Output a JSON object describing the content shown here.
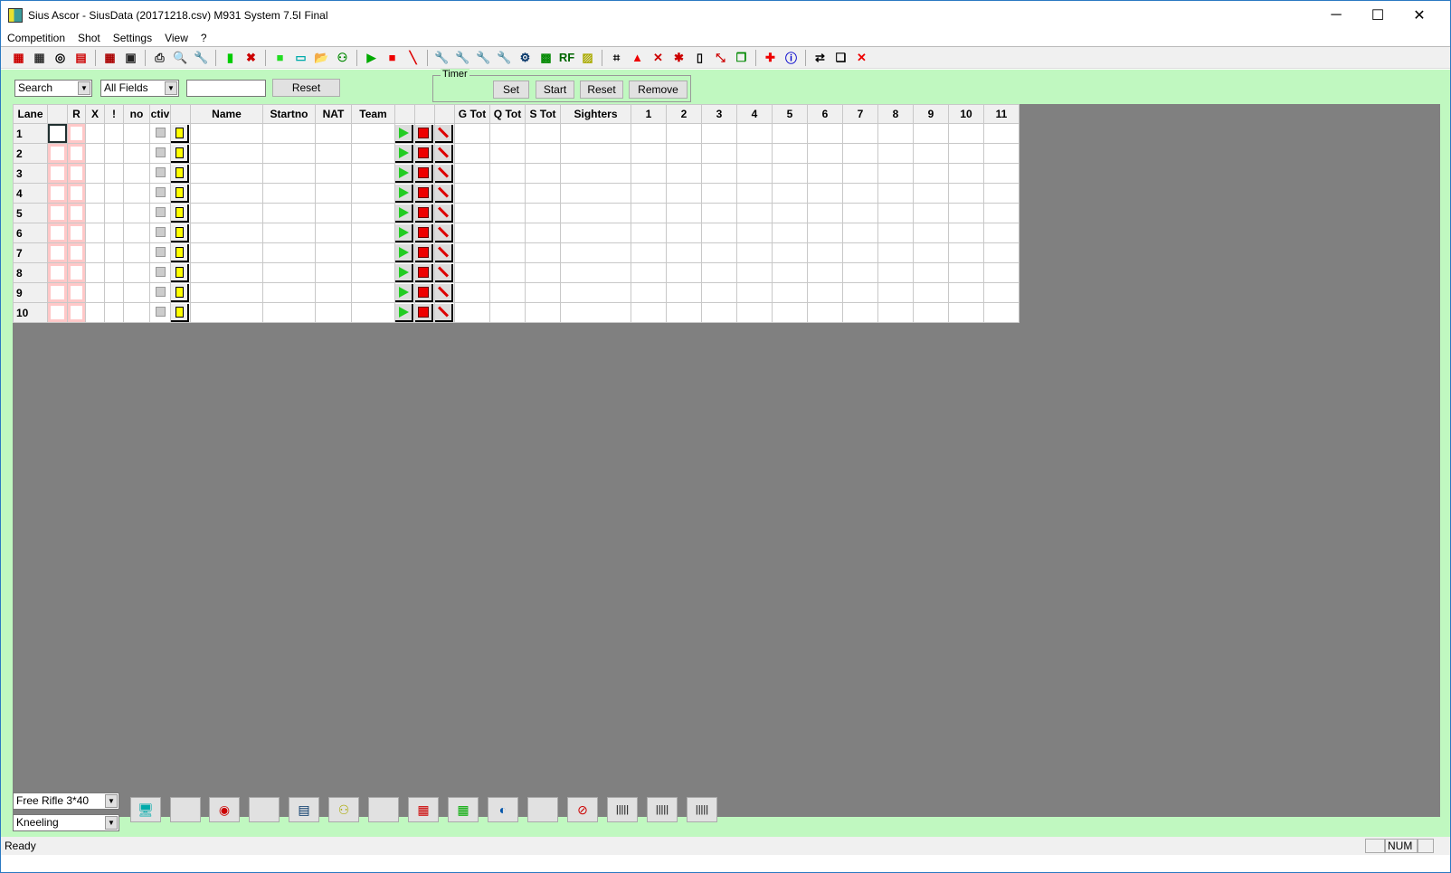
{
  "window": {
    "title": "Sius Ascor - SiusData  (20171218.csv)  M931 System 7.5I Final",
    "minimize": "─",
    "maximize": "☐",
    "close": "✕"
  },
  "menu": [
    "Competition",
    "Shot",
    "Settings",
    "View",
    "?"
  ],
  "toolbar": [
    {
      "name": "view-standard-icon",
      "glyph": "▦",
      "color": "#c00"
    },
    {
      "name": "view-grid-icon",
      "glyph": "▦",
      "color": "#333"
    },
    {
      "name": "target-icon",
      "glyph": "◎",
      "color": "#000"
    },
    {
      "name": "score-table-icon",
      "glyph": "▤",
      "color": "#c00"
    },
    {
      "sep": true
    },
    {
      "name": "color-grid-icon",
      "glyph": "▦",
      "color": "#a00"
    },
    {
      "name": "save-icon",
      "glyph": "▣",
      "color": "#222"
    },
    {
      "sep": true
    },
    {
      "name": "print-icon",
      "glyph": "⎙",
      "color": "#222"
    },
    {
      "name": "print-preview-icon",
      "glyph": "🔍",
      "color": "#05a"
    },
    {
      "name": "wrench-icon",
      "glyph": "🔧",
      "color": "#05a"
    },
    {
      "sep": true
    },
    {
      "name": "battery-green-icon",
      "glyph": "▮",
      "color": "#0c0"
    },
    {
      "name": "battery-cross-icon",
      "glyph": "✖",
      "color": "#c00"
    },
    {
      "sep": true
    },
    {
      "name": "green-square-icon",
      "glyph": "■",
      "color": "#2d2"
    },
    {
      "name": "monitor-icon",
      "glyph": "▭",
      "color": "#0aa"
    },
    {
      "name": "open-folder-icon",
      "glyph": "📂",
      "color": "#a80"
    },
    {
      "name": "shooters-icon",
      "glyph": "⚇",
      "color": "#080"
    },
    {
      "sep": true
    },
    {
      "name": "start-icon",
      "glyph": "▶",
      "color": "#0a0"
    },
    {
      "name": "stop-icon",
      "glyph": "■",
      "color": "#e00"
    },
    {
      "name": "marker-icon",
      "glyph": "╲",
      "color": "#d00"
    },
    {
      "sep": true
    },
    {
      "name": "tool1-icon",
      "glyph": "🔧",
      "color": "#036"
    },
    {
      "name": "tool2-icon",
      "glyph": "🔧",
      "color": "#080"
    },
    {
      "name": "tool3-icon",
      "glyph": "🔧",
      "color": "#c00"
    },
    {
      "name": "tool4-icon",
      "glyph": "🔧",
      "color": "#036"
    },
    {
      "name": "tool5-icon",
      "glyph": "⚙",
      "color": "#036"
    },
    {
      "name": "tool6-icon",
      "glyph": "▩",
      "color": "#080"
    },
    {
      "name": "rf-icon",
      "glyph": "RF",
      "color": "#060"
    },
    {
      "name": "tool7-icon",
      "glyph": "▨",
      "color": "#aa0"
    },
    {
      "sep": true
    },
    {
      "name": "corners-icon",
      "glyph": "⌗",
      "color": "#000"
    },
    {
      "name": "warning-icon",
      "glyph": "▲",
      "color": "#e00"
    },
    {
      "name": "warning-cross-icon",
      "glyph": "✕",
      "color": "#c00"
    },
    {
      "name": "bug-icon",
      "glyph": "✱",
      "color": "#c00"
    },
    {
      "name": "page-icon",
      "glyph": "▯",
      "color": "#000"
    },
    {
      "name": "arrows-icon",
      "glyph": "⤡",
      "color": "#c00"
    },
    {
      "name": "windows-icon",
      "glyph": "❐",
      "color": "#080"
    },
    {
      "sep": true
    },
    {
      "name": "swiss-flag-icon",
      "glyph": "✚",
      "color": "#e00"
    },
    {
      "name": "info-icon",
      "glyph": "ⓘ",
      "color": "#00c"
    },
    {
      "sep": true
    },
    {
      "name": "transfer-icon",
      "glyph": "⇄",
      "color": "#000"
    },
    {
      "name": "documents-icon",
      "glyph": "❏",
      "color": "#000"
    },
    {
      "name": "delete-docs-icon",
      "glyph": "✕",
      "color": "#e00"
    }
  ],
  "search": {
    "mode": "Search",
    "field": "All Fields",
    "query": "",
    "reset": "Reset"
  },
  "timer": {
    "label": "Timer",
    "set": "Set",
    "start": "Start",
    "reset": "Reset",
    "remove": "Remove"
  },
  "grid": {
    "headers": [
      "Lane",
      "",
      "R",
      "X",
      "!",
      "no",
      "ctiv",
      "",
      "Name",
      "Startno",
      "NAT",
      "Team",
      "",
      "",
      "",
      "G Tot",
      "Q Tot",
      "S Tot",
      "Sighters",
      "1",
      "2",
      "3",
      "4",
      "5",
      "6",
      "7",
      "8",
      "9",
      "10",
      "11"
    ],
    "lanes": [
      "1",
      "2",
      "3",
      "4",
      "5",
      "6",
      "7",
      "8",
      "9",
      "10"
    ]
  },
  "bottom": {
    "discipline": "Free Rifle 3*40",
    "position": "Kneeling",
    "buttons": [
      {
        "name": "monitor-erase-icon",
        "glyph": "🖥",
        "color": "#0aa"
      },
      {
        "name": "blank-button",
        "glyph": "",
        "color": "#000"
      },
      {
        "name": "target-rings-icon",
        "glyph": "◉",
        "color": "#c00"
      },
      {
        "name": "blank-button",
        "glyph": "",
        "color": "#000"
      },
      {
        "name": "settings-sheet-icon",
        "glyph": "▤",
        "color": "#036"
      },
      {
        "name": "targets-erase-icon",
        "glyph": "⚇",
        "color": "#aa0"
      },
      {
        "name": "blank-button",
        "glyph": "",
        "color": "#000"
      },
      {
        "name": "red-numbers-icon",
        "glyph": "▦",
        "color": "#c00"
      },
      {
        "name": "green-numbers-icon",
        "glyph": "▦",
        "color": "#0a0"
      },
      {
        "name": "camera-icon",
        "glyph": "◐",
        "color": "#05a"
      },
      {
        "name": "blank-button",
        "glyph": "",
        "color": "#000"
      },
      {
        "name": "no-marker-icon",
        "glyph": "⊘",
        "color": "#c00"
      },
      {
        "name": "barcode1-icon",
        "glyph": "|||||",
        "color": "#000"
      },
      {
        "name": "barcode2-icon",
        "glyph": "|||||",
        "color": "#000"
      },
      {
        "name": "barcode3-icon",
        "glyph": "|||||",
        "color": "#000"
      }
    ]
  },
  "status": {
    "text": "Ready",
    "num": "NUM"
  }
}
